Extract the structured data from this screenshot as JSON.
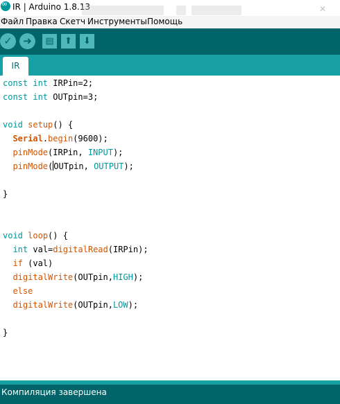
{
  "window": {
    "title": "IR | Arduino 1.8.13",
    "icon": "arduino-logo-icon"
  },
  "menu": [
    "Файл",
    "Правка",
    "Скетч",
    "Инструменты",
    "Помощь"
  ],
  "toolbar": {
    "verify_icon": "✓",
    "upload_icon": "➜",
    "new_icon": "▤",
    "open_icon": "⬆",
    "save_icon": "⬇"
  },
  "tabs": [
    {
      "label": "IR",
      "active": true
    }
  ],
  "editor": {
    "lines": [
      [
        [
          "const",
          "kw"
        ],
        [
          " ",
          ""
        ],
        [
          "int",
          "kw"
        ],
        [
          " IRPin=2;",
          ""
        ]
      ],
      [
        [
          "const",
          "kw"
        ],
        [
          " ",
          ""
        ],
        [
          "int",
          "kw"
        ],
        [
          " OUTpin=3;",
          ""
        ]
      ],
      [],
      [
        [
          "void",
          "kw"
        ],
        [
          " ",
          ""
        ],
        [
          "setup",
          "fn"
        ],
        [
          "() {",
          ""
        ]
      ],
      [
        [
          "  ",
          ""
        ],
        [
          "Serial",
          "ser"
        ],
        [
          ".",
          ""
        ],
        [
          "begin",
          "fn"
        ],
        [
          "(9600);",
          ""
        ]
      ],
      [
        [
          "  ",
          ""
        ],
        [
          "pinMode",
          "fn"
        ],
        [
          "(IRPin, ",
          ""
        ],
        [
          "INPUT",
          "kw"
        ],
        [
          ");",
          ""
        ]
      ],
      [
        [
          "  ",
          ""
        ],
        [
          "pinMode",
          "fn"
        ],
        [
          "(",
          ""
        ],
        [
          "|",
          "caret"
        ],
        [
          "OUTpin, ",
          ""
        ],
        [
          "OUTPUT",
          "kw"
        ],
        [
          ");",
          ""
        ]
      ],
      [],
      [
        [
          "}",
          ""
        ]
      ],
      [],
      [],
      [
        [
          "void",
          "kw"
        ],
        [
          " ",
          ""
        ],
        [
          "loop",
          "fn"
        ],
        [
          "() {",
          ""
        ]
      ],
      [
        [
          "  ",
          ""
        ],
        [
          "int",
          "kw"
        ],
        [
          " val=",
          ""
        ],
        [
          "digitalRead",
          "fn"
        ],
        [
          "(IRPin);",
          ""
        ]
      ],
      [
        [
          "  ",
          ""
        ],
        [
          "if",
          "fn"
        ],
        [
          " (val)",
          ""
        ]
      ],
      [
        [
          "  ",
          ""
        ],
        [
          "digitalWrite",
          "fn"
        ],
        [
          "(OUTpin,",
          ""
        ],
        [
          "HIGH",
          "kw"
        ],
        [
          ");",
          ""
        ]
      ],
      [
        [
          "  ",
          ""
        ],
        [
          "else",
          "fn"
        ]
      ],
      [
        [
          "  ",
          ""
        ],
        [
          "digitalWrite",
          "fn"
        ],
        [
          "(OUTpin,",
          ""
        ],
        [
          "LOW",
          "kw"
        ],
        [
          ");",
          ""
        ]
      ],
      [],
      [
        [
          "}",
          ""
        ]
      ]
    ]
  },
  "status": {
    "message": "Компиляция завершена"
  },
  "colors": {
    "toolbar_bg": "#006468",
    "tab_strip": "#17a1a5",
    "button_face": "#4db7bb",
    "keyword": "#00979c",
    "function": "#d35400"
  }
}
